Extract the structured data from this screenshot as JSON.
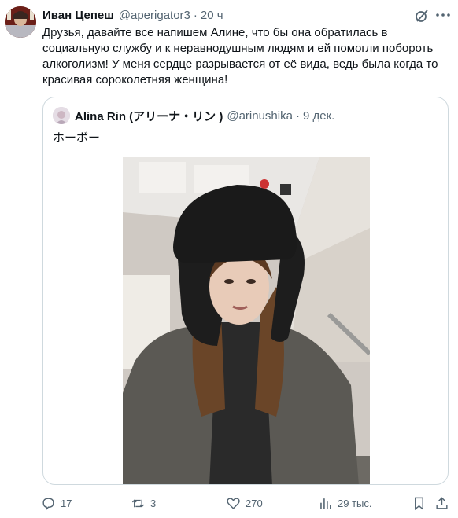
{
  "tweet": {
    "author_name": "Иван Цепеш",
    "author_handle": "@aperigator3",
    "separator": "·",
    "time": "20 ч",
    "text": "Друзья, давайте все напишем Алине, что бы она обратилась в социальную службу и к неравнодушным людям и ей помогли побороть алкоголизм! У меня сердце разрывается от её вида, ведь была когда то красивая сороколетняя женщина!"
  },
  "quoted": {
    "author_name": "Alina Rin (アリーナ・リン )",
    "author_handle": "@arinushika",
    "separator": "·",
    "time": "9 дек.",
    "text": "ホーボー"
  },
  "actions": {
    "replies": "17",
    "reposts": "3",
    "likes": "270",
    "views": "29 тыс."
  },
  "colors": {
    "text": "#0f1419",
    "secondary": "#536471",
    "border": "#cfd9de"
  }
}
